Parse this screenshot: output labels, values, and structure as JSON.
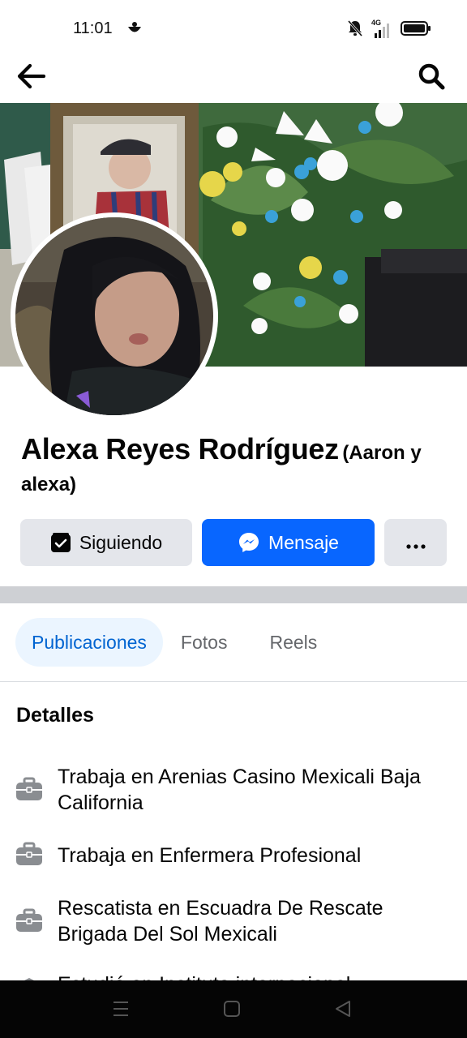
{
  "status_bar": {
    "time": "11:01",
    "network": "4G",
    "icons": [
      "app-notification-icon",
      "bell-off-icon",
      "signal-icon",
      "battery-icon"
    ]
  },
  "top_nav": {
    "back_icon": "arrow-left-icon",
    "search_icon": "search-icon"
  },
  "profile": {
    "name": "Alexa Reyes Rodríguez",
    "alternate_name": "(Aaron y alexa)"
  },
  "actions": {
    "follow_label": "Siguiendo",
    "message_label": "Mensaje",
    "more_label": "···"
  },
  "tabs": [
    {
      "label": "Publicaciones",
      "active": true
    },
    {
      "label": "Fotos",
      "active": false
    },
    {
      "label": "Reels",
      "active": false
    }
  ],
  "details": {
    "title": "Detalles",
    "items": [
      {
        "icon": "briefcase-icon",
        "text": "Trabaja en Arenias Casino Mexicali Baja California"
      },
      {
        "icon": "briefcase-icon",
        "text": "Trabaja en Enfermera Profesional"
      },
      {
        "icon": "briefcase-icon",
        "text": "Rescatista en Escuadra De Rescate Brigada Del Sol Mexicali"
      },
      {
        "icon": "education-icon",
        "text": "Estudió en Instituto internacional"
      }
    ]
  },
  "colors": {
    "brand_blue": "#0866ff",
    "active_tab_bg": "#ebf5ff",
    "active_tab_text": "#0064d1",
    "button_grey": "#e4e6eb"
  }
}
